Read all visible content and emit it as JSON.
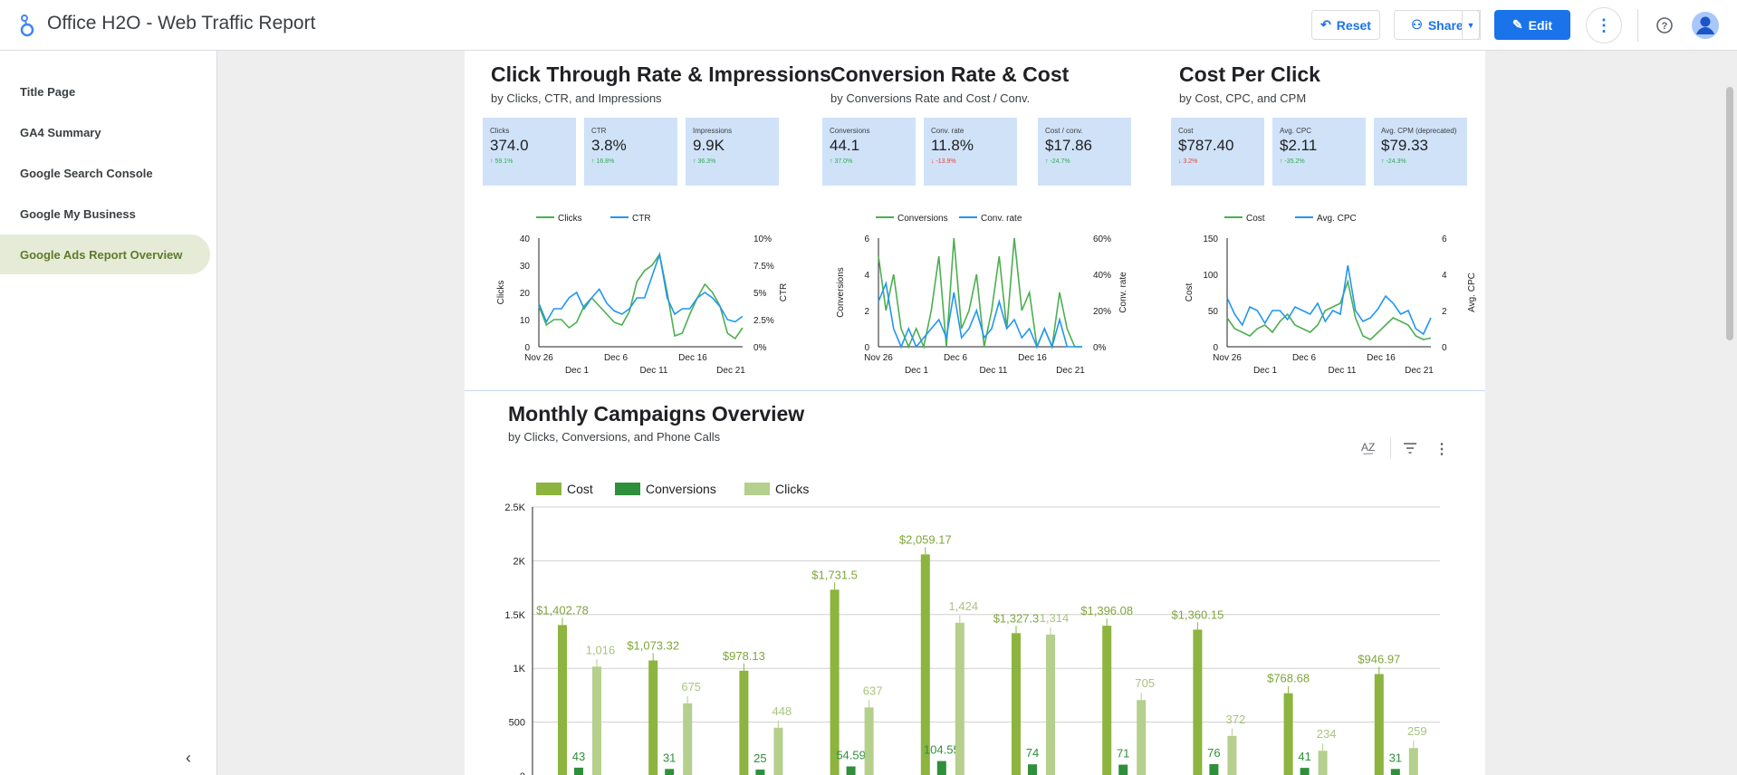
{
  "app": {
    "title": "Office H2O - Web Traffic Report"
  },
  "toolbar": {
    "reset": "Reset",
    "share": "Share",
    "edit": "Edit"
  },
  "sidebar": {
    "items": [
      {
        "label": "Title Page",
        "active": false
      },
      {
        "label": "GA4 Summary",
        "active": false
      },
      {
        "label": "Google Search Console",
        "active": false
      },
      {
        "label": "Google My Business",
        "active": false
      },
      {
        "label": "Google Ads Report Overview",
        "active": true
      }
    ]
  },
  "sections": [
    {
      "title": "Click Through Rate & Impressions",
      "subtitle": "by Clicks, CTR, and Impressions",
      "kpis": [
        {
          "label": "Clicks",
          "value": "374.0",
          "delta": "59.1%",
          "dir": "up"
        },
        {
          "label": "CTR",
          "value": "3.8%",
          "delta": "16.8%",
          "dir": "up"
        },
        {
          "label": "Impressions",
          "value": "9.9K",
          "delta": "36.3%",
          "dir": "up"
        }
      ]
    },
    {
      "title": "Conversion Rate & Cost",
      "subtitle": "by Conversions Rate and Cost / Conv.",
      "kpis": [
        {
          "label": "Conversions",
          "value": "44.1",
          "delta": "37.0%",
          "dir": "up"
        },
        {
          "label": "Conv. rate",
          "value": "11.8%",
          "delta": "-13.9%",
          "dir": "down"
        },
        {
          "label": "Cost / conv.",
          "value": "$17.86",
          "delta": "-24.7%",
          "dir": "up"
        }
      ]
    },
    {
      "title": "Cost Per Click",
      "subtitle": "by Cost, CPC, and CPM",
      "kpis": [
        {
          "label": "Cost",
          "value": "$787.40",
          "delta": "3.2%",
          "dir": "down"
        },
        {
          "label": "Avg. CPC",
          "value": "$2.11",
          "delta": "-35.2%",
          "dir": "up"
        },
        {
          "label": "Avg. CPM (deprecated)",
          "value": "$79.33",
          "delta": "-24.3%",
          "dir": "up"
        }
      ]
    }
  ],
  "monthly": {
    "title": "Monthly Campaigns Overview",
    "subtitle": "by Clicks, Conversions, and Phone Calls"
  },
  "chart_data": [
    {
      "type": "line",
      "series": [
        {
          "name": "Clicks",
          "axis": "left",
          "color": "#4caf50",
          "values": [
            15,
            8,
            10,
            10,
            7,
            9,
            15,
            18,
            15,
            12,
            9,
            8,
            13,
            24,
            28,
            30,
            34,
            20,
            4,
            5,
            12,
            18,
            23,
            20,
            15,
            5,
            3,
            7
          ]
        },
        {
          "name": "CTR",
          "axis": "right",
          "color": "#2196f3",
          "values": [
            4,
            2.3,
            3.5,
            3.5,
            4.5,
            5,
            3.5,
            4.5,
            5.3,
            4,
            3.3,
            3,
            3.5,
            4.5,
            4.5,
            6.5,
            8.5,
            4.5,
            3,
            3.5,
            3.5,
            4.5,
            5,
            4.5,
            3.7,
            2.5,
            2.3,
            2.8
          ]
        }
      ],
      "x_ticks_top": [
        "Nov 26",
        "Dec 6",
        "Dec 16"
      ],
      "x_ticks_bottom": [
        "Dec 1",
        "Dec 11",
        "Dec 21"
      ],
      "ylabel_left": "Clicks",
      "ylabel_right": "CTR",
      "y_left_ticks": [
        "40",
        "30",
        "20",
        "10",
        "0"
      ],
      "y_right_ticks": [
        "10%",
        "7.5%",
        "5%",
        "2.5%",
        "0%"
      ],
      "ylim_left": [
        0,
        40
      ],
      "ylim_right": [
        0,
        10
      ]
    },
    {
      "type": "line",
      "series": [
        {
          "name": "Conversions",
          "axis": "left",
          "color": "#4caf50",
          "values": [
            5,
            2,
            4,
            1,
            0,
            1,
            0,
            2,
            5,
            0,
            6,
            1,
            2,
            4,
            0,
            2,
            5,
            1,
            6,
            2,
            3,
            0,
            1,
            0,
            3,
            1,
            0,
            0
          ]
        },
        {
          "name": "Conv. rate",
          "axis": "right",
          "color": "#2196f3",
          "values": [
            25,
            35,
            10,
            0,
            10,
            0,
            5,
            10,
            15,
            5,
            30,
            5,
            10,
            20,
            5,
            10,
            25,
            10,
            15,
            5,
            10,
            0,
            10,
            0,
            15,
            0,
            0,
            0
          ]
        }
      ],
      "x_ticks_top": [
        "Nov 26",
        "Dec 6",
        "Dec 16"
      ],
      "x_ticks_bottom": [
        "Dec 1",
        "Dec 11",
        "Dec 21"
      ],
      "ylabel_left": "Conversions",
      "ylabel_right": "Conv. rate",
      "y_left_ticks": [
        "6",
        "4",
        "2",
        "0"
      ],
      "y_right_ticks": [
        "60%",
        "40%",
        "20%",
        "0%"
      ],
      "ylim_left": [
        0,
        6
      ],
      "ylim_right": [
        0,
        60
      ]
    },
    {
      "type": "line",
      "series": [
        {
          "name": "Cost",
          "axis": "left",
          "color": "#4caf50",
          "values": [
            40,
            25,
            20,
            15,
            25,
            30,
            20,
            35,
            45,
            30,
            25,
            20,
            30,
            50,
            55,
            60,
            90,
            40,
            15,
            10,
            20,
            30,
            40,
            35,
            30,
            15,
            10,
            12
          ]
        },
        {
          "name": "Avg. CPC",
          "axis": "right",
          "color": "#2196f3",
          "values": [
            2.7,
            1.8,
            1.2,
            2.2,
            2,
            1.3,
            2,
            2,
            1.5,
            2.2,
            2,
            1.8,
            2.4,
            1.4,
            2,
            1.8,
            4.5,
            2,
            1.4,
            1.6,
            2.1,
            2.8,
            2.4,
            1.8,
            2,
            1,
            0.7,
            1.6
          ]
        }
      ],
      "x_ticks_top": [
        "Nov 26",
        "Dec 6",
        "Dec 16"
      ],
      "x_ticks_bottom": [
        "Dec 1",
        "Dec 11",
        "Dec 21"
      ],
      "ylabel_left": "Cost",
      "ylabel_right": "Avg. CPC",
      "y_left_ticks": [
        "150",
        "100",
        "50",
        "0"
      ],
      "y_right_ticks": [
        "6",
        "4",
        "2",
        "0"
      ],
      "ylim_left": [
        0,
        150
      ],
      "ylim_right": [
        0,
        6
      ]
    },
    {
      "type": "bar",
      "ylim": [
        0,
        2500
      ],
      "y_ticks": [
        "2.5K",
        "2K",
        "1.5K",
        "1K",
        "500",
        "0"
      ],
      "legend": [
        {
          "name": "Cost",
          "color": "#8cb43f"
        },
        {
          "name": "Conversions",
          "color": "#2f8f3a"
        },
        {
          "name": "Clicks",
          "color": "#b5cf8d"
        }
      ],
      "groups": [
        {
          "cost": 1402.78,
          "cost_label": "$1,402.78",
          "conv": 43,
          "conv_label": "43",
          "clicks": 1016,
          "clicks_label": "1,016"
        },
        {
          "cost": 1073.32,
          "cost_label": "$1,073.32",
          "conv": 31,
          "conv_label": "31",
          "clicks": 675,
          "clicks_label": "675"
        },
        {
          "cost": 978.13,
          "cost_label": "$978.13",
          "conv": 25,
          "conv_label": "25",
          "clicks": 448,
          "clicks_label": "448"
        },
        {
          "cost": 1731.5,
          "cost_label": "$1,731.5",
          "conv": 54.59,
          "conv_label": "54.59",
          "clicks": 637,
          "clicks_label": "637"
        },
        {
          "cost": 2059.17,
          "cost_label": "$2,059.17",
          "conv": 104.55,
          "conv_label": "104.55",
          "clicks": 1424,
          "clicks_label": "1,424"
        },
        {
          "cost": 1327.3,
          "cost_label": "$1,327.3",
          "conv": 74,
          "conv_label": "74",
          "clicks": 1314,
          "clicks_label": "1,314"
        },
        {
          "cost": 1396.08,
          "cost_label": "$1,396.08",
          "conv": 71,
          "conv_label": "71",
          "clicks": 705,
          "clicks_label": "705"
        },
        {
          "cost": 1360.15,
          "cost_label": "$1,360.15",
          "conv": 76,
          "conv_label": "76",
          "clicks": 372,
          "clicks_label": "372"
        },
        {
          "cost": 768.68,
          "cost_label": "$768.68",
          "conv": 41,
          "conv_label": "41",
          "clicks": 234,
          "clicks_label": "234"
        },
        {
          "cost": 946.97,
          "cost_label": "$946.97",
          "conv": 31,
          "conv_label": "31",
          "clicks": 259,
          "clicks_label": "259"
        }
      ]
    }
  ]
}
